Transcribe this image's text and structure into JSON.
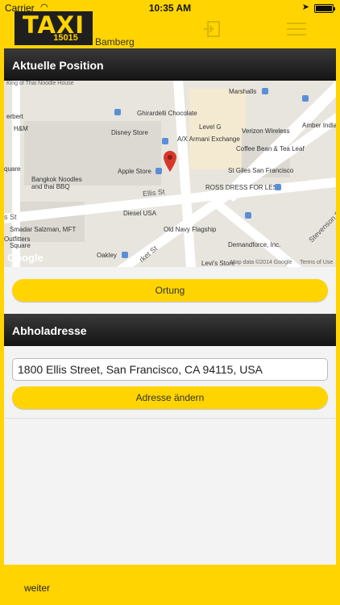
{
  "status_bar": {
    "carrier": "Carrier",
    "time": "10:35 AM"
  },
  "header": {
    "logo_word": "TAXI",
    "logo_number": "15015",
    "city": "Bamberg"
  },
  "position_section": {
    "title": "Aktuelle Position",
    "locate_button": "Ortung"
  },
  "map": {
    "places": [
      "King of Thai Noodle House",
      "erbert",
      "H&M",
      "Ghirardelli Chocolate",
      "Marshalls",
      "Level G",
      "Disney Store",
      "A/X Armani Exchange",
      "Verizon Wireless",
      "Amber India",
      "Coffee Bean & Tea Leaf",
      "quare",
      "Bangkok Noodles and thai BBQ",
      "Apple Store",
      "St Giles San Francisco",
      "ROSS DRESS FOR LESS",
      "Diesel USA",
      "Smadar Salzman, MFT",
      "Outfitters",
      "Square",
      "Old Navy Flagship",
      "Demandforce, Inc.",
      "Oakley",
      "Levi's Store"
    ],
    "streets": [
      "Ellis St",
      "Stevenson St",
      "s St",
      "rket St"
    ],
    "attribution": "Map data ©2014 Google",
    "terms": "Terms of Use",
    "google_logo": "Google"
  },
  "pickup_section": {
    "title": "Abholadresse",
    "address_value": "1800 Ellis Street, San Francisco, CA 94115, USA",
    "change_button": "Adresse ändern"
  },
  "footer": {
    "next_label": "weiter"
  },
  "colors": {
    "accent": "#ffd400",
    "header_bar": "#1f1f1f",
    "panel": "#f3f3f3"
  }
}
